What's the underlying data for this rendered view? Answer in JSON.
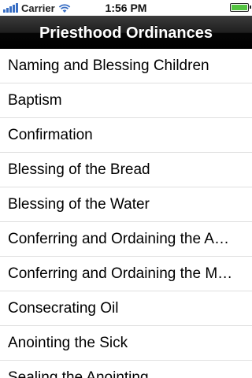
{
  "status_bar": {
    "carrier": "Carrier",
    "time": "1:56 PM",
    "signal_icon": "signal-bars-icon",
    "wifi_icon": "wifi-icon",
    "battery_icon": "battery-icon",
    "battery_color": "#54c441"
  },
  "nav": {
    "title": "Priesthood Ordinances"
  },
  "list": {
    "items": [
      {
        "label": "Naming and Blessing Children"
      },
      {
        "label": "Baptism"
      },
      {
        "label": "Confirmation"
      },
      {
        "label": "Blessing of the Bread"
      },
      {
        "label": "Blessing of the Water"
      },
      {
        "label": "Conferring and Ordaining the Aaronic Priesthood"
      },
      {
        "label": "Conferring and Ordaining the Melchizedek Priesthood"
      },
      {
        "label": "Consecrating Oil"
      },
      {
        "label": "Anointing the Sick"
      },
      {
        "label": "Sealing the Anointing"
      }
    ]
  }
}
